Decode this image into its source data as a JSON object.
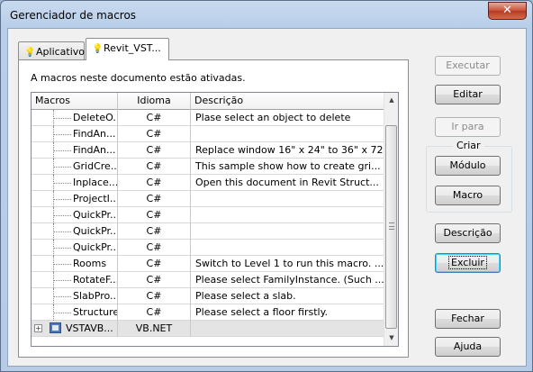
{
  "window": {
    "title": "Gerenciador de macros",
    "close_glyph": "✕"
  },
  "tabs": [
    {
      "label": "Aplicativo",
      "icon": "bulb-icon",
      "active": false
    },
    {
      "label": "Revit_VST...",
      "icon": "bulb-icon",
      "active": true
    }
  ],
  "info_text": "A macros neste documento estão ativadas.",
  "grid": {
    "columns": [
      "Macros",
      "Idioma",
      "Descrição"
    ],
    "rows": [
      {
        "name": "DeleteO...",
        "lang": "C#",
        "desc": "Plase select an object to delete"
      },
      {
        "name": "FindAn...",
        "lang": "C#",
        "desc": ""
      },
      {
        "name": "FindAn...",
        "lang": "C#",
        "desc": "Replace window 16\" x 24\" to 36\" x 72\""
      },
      {
        "name": "GridCre...",
        "lang": "C#",
        "desc": "This sample show how to create gri..."
      },
      {
        "name": "Inplace...",
        "lang": "C#",
        "desc": "Open this document in Revit Struct..."
      },
      {
        "name": "ProjectI...",
        "lang": "C#",
        "desc": ""
      },
      {
        "name": "QuickPr...",
        "lang": "C#",
        "desc": ""
      },
      {
        "name": "QuickPr...",
        "lang": "C#",
        "desc": ""
      },
      {
        "name": "QuickPr...",
        "lang": "C#",
        "desc": ""
      },
      {
        "name": "Rooms",
        "lang": "C#",
        "desc": "Switch to Level 1 to run this macro. ..."
      },
      {
        "name": "RotateF...",
        "lang": "C#",
        "desc": "Please select FamilyInstance. (Such ..."
      },
      {
        "name": "SlabPro...",
        "lang": "C#",
        "desc": "Please select a slab."
      },
      {
        "name": "Structure",
        "lang": "C#",
        "desc": "Please select a floor firstly."
      }
    ],
    "group_row": {
      "name": "VSTAVB...",
      "lang": "VB.NET",
      "desc": "",
      "expander": "+"
    }
  },
  "scrollbar": {
    "up_glyph": "▲",
    "down_glyph": "▼"
  },
  "buttons": {
    "executar": {
      "label": "Executar",
      "enabled": false
    },
    "editar": {
      "label": "Editar",
      "enabled": true
    },
    "ir_para": {
      "label": "Ir para",
      "enabled": false
    },
    "criar_group": "Criar",
    "modulo": {
      "label": "Módulo",
      "enabled": true
    },
    "macro": {
      "label": "Macro",
      "enabled": true
    },
    "descricao": {
      "label": "Descrição",
      "enabled": true
    },
    "excluir": {
      "label": "Excluir",
      "enabled": true
    },
    "fechar": {
      "label": "Fechar",
      "enabled": true
    },
    "ajuda": {
      "label": "Ajuda",
      "enabled": true
    }
  },
  "colors": {
    "accent": "#3c7fb1",
    "close_button": "#c84f37",
    "group_row": "#e4e4e4"
  }
}
